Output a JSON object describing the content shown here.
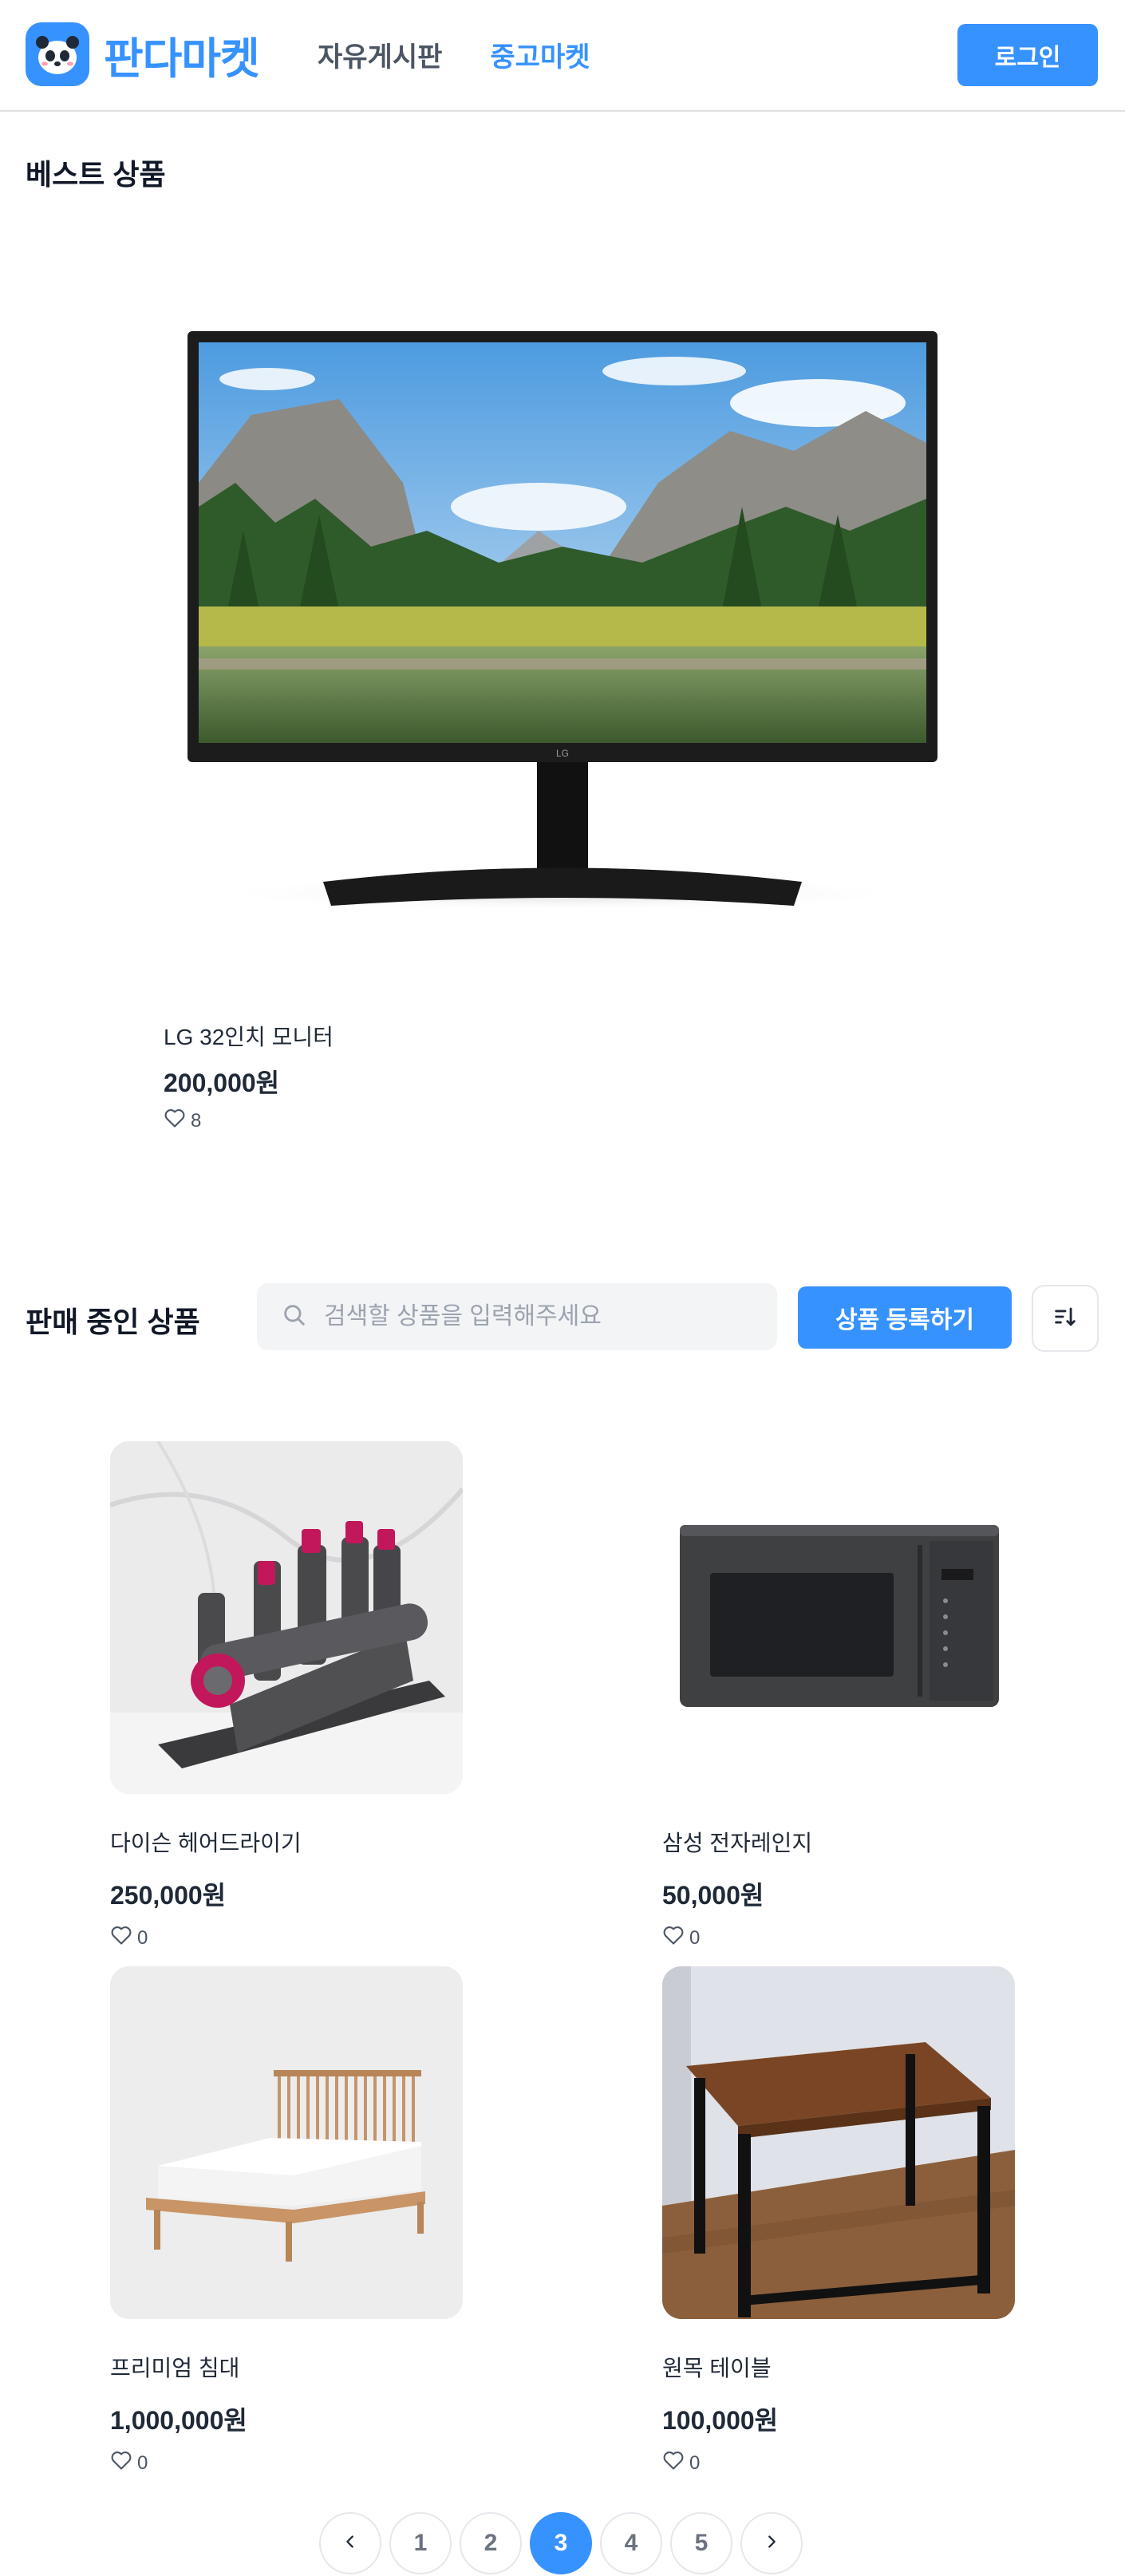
{
  "header": {
    "logo_text": "판다마켓",
    "nav": [
      {
        "label": "자유게시판",
        "active": false
      },
      {
        "label": "중고마켓",
        "active": true
      }
    ],
    "login_label": "로그인"
  },
  "best": {
    "title": "베스트 상품",
    "items": [
      {
        "name": "LG 32인치 모니터",
        "price": "200,000원",
        "likes": "8",
        "image_icon": "monitor-image"
      }
    ]
  },
  "sale": {
    "title": "판매 중인 상품",
    "search_placeholder": "검색할 상품을 입력해주세요",
    "register_label": "상품 등록하기",
    "items": [
      {
        "name": "다이슨 헤어드라이기",
        "price": "250,000원",
        "likes": "0",
        "image_icon": "hair-dryer-image"
      },
      {
        "name": "삼성 전자레인지",
        "price": "50,000원",
        "likes": "0",
        "image_icon": "microwave-image"
      },
      {
        "name": "프리미엄 침대",
        "price": "1,000,000원",
        "likes": "0",
        "image_icon": "bed-image"
      },
      {
        "name": "원목 테이블",
        "price": "100,000원",
        "likes": "0",
        "image_icon": "table-image"
      }
    ]
  },
  "pagination": {
    "pages": [
      "1",
      "2",
      "3",
      "4",
      "5"
    ],
    "current": "3"
  },
  "colors": {
    "brand": "#3692ff",
    "text": "#1f2937",
    "muted": "#9ca3af"
  }
}
